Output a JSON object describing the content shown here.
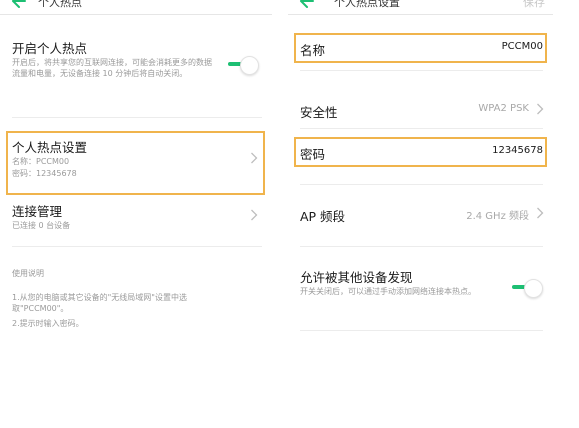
{
  "left": {
    "header_title": "个人热点",
    "hotspot_toggle": {
      "title": "开启个人热点",
      "description": "开启后，将共享您的互联网连接，可能会消耗更多的数据流量和电量，无设备连接 10 分钟后将自动关闭。",
      "on": true
    },
    "hotspot_settings": {
      "title": "个人热点设置",
      "name_line": "名称：PCCM00",
      "password_line": "密码：12345678"
    },
    "connection_management": {
      "title": "连接管理",
      "subtitle": "已连接 0 台设备"
    },
    "instructions": {
      "heading": "使用说明",
      "step1": "1.从您的电脑或其它设备的\"无线局域网\"设置中选取\"PCCM00\"。",
      "step2": "2.提示时输入密码。"
    }
  },
  "right": {
    "header_title": "个人热点设置",
    "save_label": "保存",
    "name": {
      "label": "名称",
      "value": "PCCM00"
    },
    "security": {
      "label": "安全性",
      "value": "WPA2 PSK"
    },
    "password": {
      "label": "密码",
      "value": "12345678"
    },
    "ap_band": {
      "label": "AP 频段",
      "value": "2.4 GHz 频段"
    },
    "discoverable": {
      "title": "允许被其他设备发现",
      "description": "开关关闭后，可以通过手动添加网络连接本热点。",
      "on": true
    }
  },
  "colors": {
    "accent_green": "#1dbf73",
    "highlight_orange": "#f0b44c",
    "secondary_text": "#9a9a9a",
    "separator": "#ececec"
  }
}
